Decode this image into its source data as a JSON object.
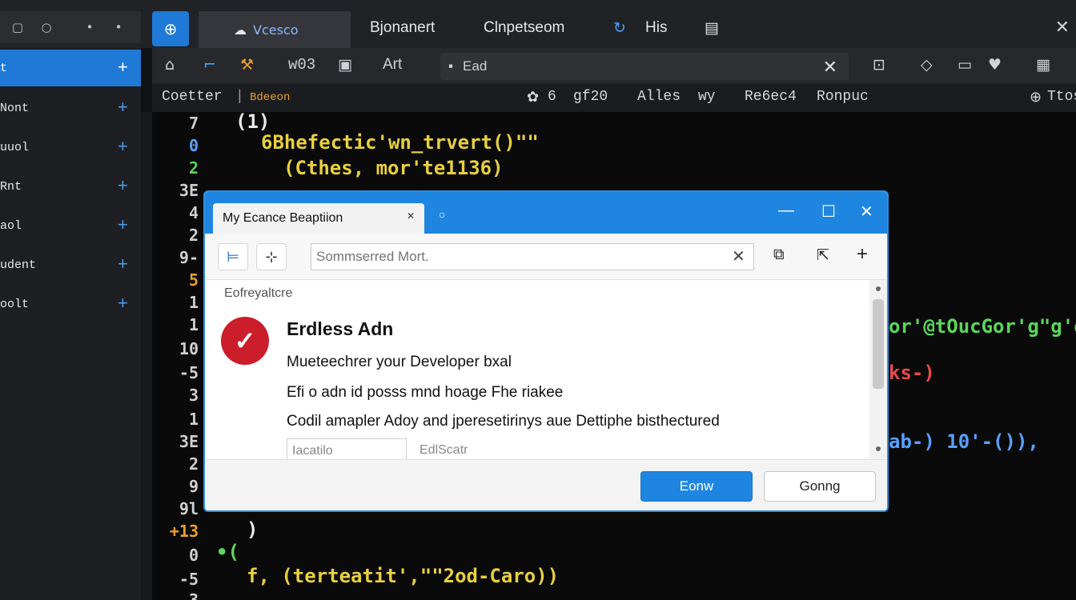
{
  "topbar": {
    "tabs": [
      "Bjonanert",
      "Clnpetseom",
      "His"
    ],
    "active_tab_label": "Vcesco"
  },
  "toolbar": {
    "label_1": "w03",
    "label_2": "Art",
    "address_text": "Ead"
  },
  "statusrow": {
    "left": "Coetter",
    "left_sub": "Bdeeon",
    "items": [
      "6",
      "gf20",
      "Alles",
      "wy",
      "Re6ec4",
      "Ronpuc"
    ],
    "right": "Ttos"
  },
  "sidebar": {
    "items": [
      {
        "label": "t"
      },
      {
        "label": "Nont"
      },
      {
        "label": "uuol"
      },
      {
        "label": "Rnt"
      },
      {
        "label": "aol"
      },
      {
        "label": "udent"
      },
      {
        "label": "oolt"
      }
    ]
  },
  "code": {
    "line_numbers": [
      "7",
      "0",
      "2",
      "3E",
      "4",
      "2",
      "9-",
      "5",
      "1",
      "1",
      "10",
      "-5",
      "3",
      "1",
      "3E",
      "2",
      "9",
      "9l",
      "+13",
      "0",
      "-5",
      "3"
    ],
    "lines": [
      {
        "text": "(1)",
        "color": "#e8e8e8"
      },
      {
        "text": "6Bhefectic'wn_trvert()\"\"",
        "color": "#e8d040"
      },
      {
        "text": "(Cthes, mor'te1136)",
        "color": "#e8d040"
      },
      {
        "text": "or'@tOucGor'g\"g'ofo",
        "color": "#5cd65c"
      },
      {
        "text": "ks-)",
        "color": "#e84a4a"
      },
      {
        "text": "ab-) 10'-()),",
        "color": "#5aa0ff"
      },
      {
        "text": ")",
        "color": "#e8e8e8"
      },
      {
        "text": "•(",
        "color": "#5cd65c"
      },
      {
        "text": "f, (terteatit',\"\"2od-Caro))",
        "color": "#e8d040"
      }
    ]
  },
  "dialog": {
    "tab_title": "My Ecance Beaptiion",
    "search_placeholder": "Sommserred Mort.",
    "breadcrumb": "Eofreyaltcre",
    "heading": "Erdless Adn",
    "paragraphs": [
      "Mueteechrer your Developer bxal",
      "Efi o adn id posss mnd hoage Fhe riakee",
      "Codil amapler Adoy and jperesetirinys aue Dettiphe bisthectured"
    ],
    "field_value": "Iacatilo",
    "field_label": "EdlScatr",
    "primary_button": "Eonw",
    "secondary_button": "Gonng"
  },
  "colors": {
    "accent": "#1e86e0",
    "badge": "#cc1d2a",
    "background": "#0a0a0b"
  }
}
